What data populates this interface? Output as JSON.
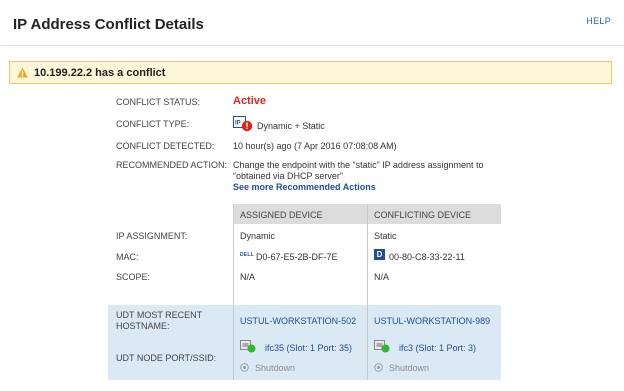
{
  "header": {
    "title": "IP Address Conflict Details",
    "help": "HELP"
  },
  "alert": {
    "text": "10.199.22.2 has a conflict"
  },
  "details": {
    "status_label": "CONFLICT STATUS:",
    "status_value": "Active",
    "type_label": "CONFLICT TYPE:",
    "type_value": "Dynamic + Static",
    "detected_label": "CONFLICT DETECTED:",
    "detected_value": "10 hour(s) ago (7 Apr 2016 07:08:08 AM)",
    "action_label": "RECOMMENDED ACTION:",
    "action_line1": "Change the endpoint with the “static” IP address assignment to",
    "action_line2": "“obtained via DHCP server”",
    "action_link": "See more Recommended Actions"
  },
  "grid": {
    "columns": [
      "ASSIGNED DEVICE",
      "CONFLICTING DEVICE"
    ],
    "rows": {
      "ip_assignment_label": "IP ASSIGNMENT:",
      "mac_label": "MAC:",
      "scope_label": "SCOPE:",
      "hostname_label_1": "UDT MOST RECENT",
      "hostname_label_2": "HOSTNAME:",
      "port_label": "UDT NODE PORT/SSID:"
    },
    "assigned": {
      "ip_assignment": "Dynamic",
      "vendor_logo": "DELL",
      "mac": "D0-67-E5-2B-DF-7E",
      "scope": "N/A",
      "hostname": "USTUL-WORKSTATION-502",
      "port": "ifc35 (Slot: 1 Port: 35)",
      "port_status": "Shutdown"
    },
    "conflicting": {
      "ip_assignment": "Static",
      "vendor_logo": "D",
      "mac": "00-80-C8-33-22-11",
      "scope": "N/A",
      "hostname": "USTUL-WORKSTATION-989",
      "port": "ifc3 (Slot: 1 Port: 3)",
      "port_status": "Shutdown"
    }
  },
  "colors": {
    "accent": "#1e4e9a",
    "alert_bg": "#fdf6d9",
    "alert_border": "#f0c36d",
    "active": "#e2231a",
    "udt_bg": "#dbe9f5",
    "status_up": "#2eb82e"
  },
  "icons": {
    "alert": "warning-triangle-icon",
    "type": "ip-conflict-icon",
    "port": "port-up-icon",
    "shutdown": "shutdown-icon"
  }
}
